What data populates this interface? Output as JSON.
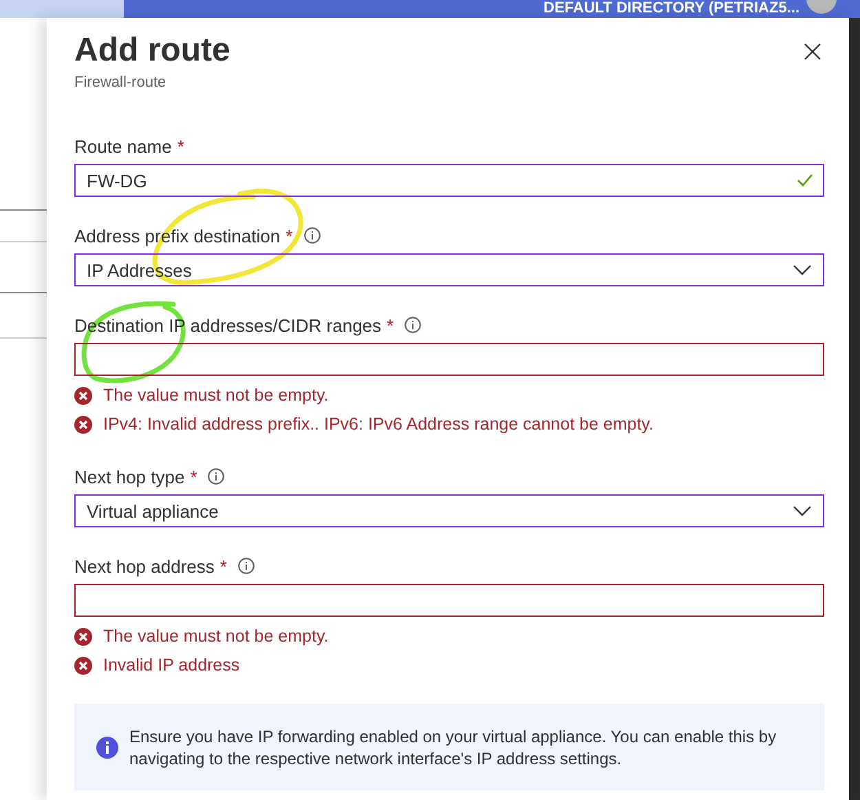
{
  "top_bar": {
    "directory": "DEFAULT DIRECTORY (PETRIAZ5..."
  },
  "panel": {
    "title": "Add route",
    "subtitle": "Firewall-route"
  },
  "fields": [
    {
      "kind": "text",
      "label": "Route name",
      "required_mark": "*",
      "value": "FW-DG",
      "focused": true,
      "valid": true,
      "invalid": false
    },
    {
      "kind": "select",
      "label": "Address prefix destination",
      "required_mark": "*",
      "info": true,
      "value": "IP Addresses",
      "focused": true,
      "invalid": false
    },
    {
      "kind": "text",
      "label": "Destination IP addresses/CIDR ranges",
      "required_mark": "*",
      "info": true,
      "invalid": true,
      "errors": [
        "The value must not be empty.",
        "IPv4: Invalid address prefix.. IPv6: IPv6 Address range cannot be empty."
      ]
    },
    {
      "kind": "select",
      "label": "Next hop type",
      "required_mark": "*",
      "info": true,
      "value": "Virtual appliance",
      "focused": true,
      "invalid": false
    },
    {
      "kind": "text",
      "label": "Next hop address",
      "required_mark": "*",
      "info": true,
      "invalid": true,
      "errors": [
        "The value must not be empty.",
        "Invalid IP address"
      ]
    }
  ],
  "info_box": {
    "text": "Ensure you have IP forwarding enabled on your virtual appliance. You can enable this by navigating to the respective network interface's IP address settings."
  },
  "annotations": [
    {
      "kind": "circle",
      "color": "#f2e637"
    },
    {
      "kind": "circle",
      "color": "#72e33c"
    }
  ]
}
